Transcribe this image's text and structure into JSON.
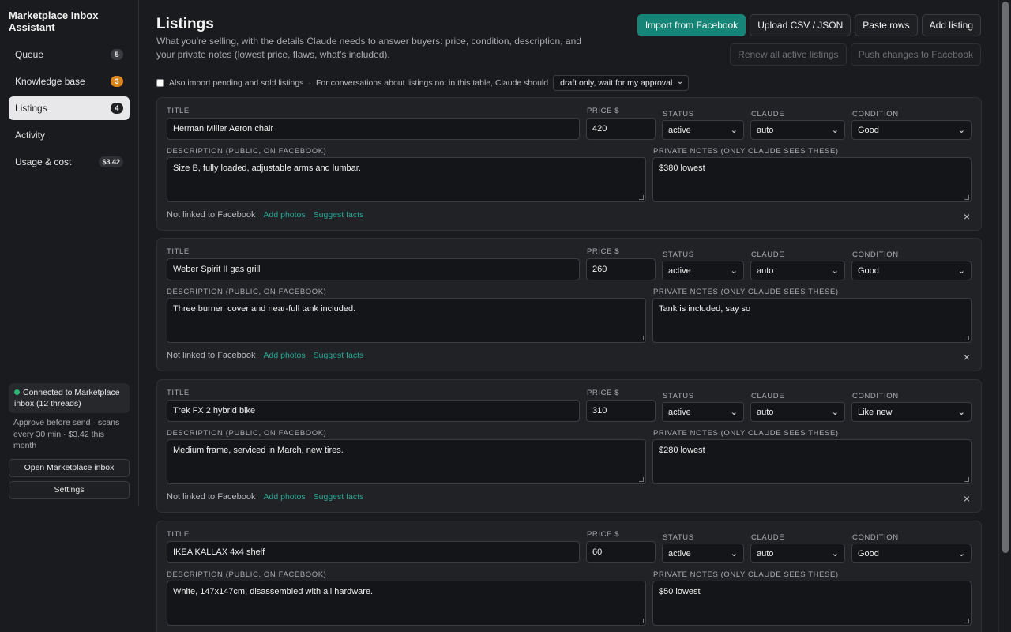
{
  "sidebar": {
    "brand": "Marketplace Inbox Assistant",
    "items": [
      {
        "label": "Queue",
        "badge": "5"
      },
      {
        "label": "Knowledge base",
        "badge": "3"
      },
      {
        "label": "Listings",
        "badge": "4"
      },
      {
        "label": "Activity",
        "badge": ""
      },
      {
        "label": "Usage & cost",
        "badge": "$3.42"
      }
    ],
    "connection": "Connected to Marketplace inbox (12 threads)",
    "status_sub": "Approve before send · scans every 30 min · $3.42 this month",
    "open_inbox": "Open Marketplace inbox",
    "settings": "Settings"
  },
  "header": {
    "title": "Listings",
    "subtitle": "What you're selling, with the details Claude needs to answer buyers: price, condition, description, and your private notes (lowest price, flaws, what's included).",
    "import_fb": "Import from Facebook",
    "upload_csv": "Upload CSV / JSON",
    "paste_rows": "Paste rows",
    "add_listing": "Add listing",
    "renew_all": "Renew all active listings",
    "push_changes": "Push changes to Facebook"
  },
  "import_options": {
    "checkbox_label": "Also import pending and sold listings",
    "separator": "·",
    "policy_label": "For conversations about listings not in this table, Claude should",
    "policy_value": "draft only, wait for my approval"
  },
  "labels": {
    "title": "TITLE",
    "price": "PRICE $",
    "status": "STATUS",
    "claude": "CLAUDE",
    "condition": "CONDITION",
    "description": "DESCRIPTION (PUBLIC, ON FACEBOOK)",
    "private_notes": "PRIVATE NOTES (ONLY CLAUDE SEES THESE)",
    "not_linked": "Not linked to Facebook",
    "add_photos": "Add photos",
    "suggest_facts": "Suggest facts",
    "remove": "×"
  },
  "listings": [
    {
      "title": "Herman Miller Aeron chair",
      "price": "420",
      "status": "active",
      "claude": "auto",
      "condition": "Good",
      "description": "Size B, fully loaded, adjustable arms and lumbar.",
      "notes": "$380 lowest"
    },
    {
      "title": "Weber Spirit II gas grill",
      "price": "260",
      "status": "active",
      "claude": "auto",
      "condition": "Good",
      "description": "Three burner, cover and near-full tank included.",
      "notes": "Tank is included, say so"
    },
    {
      "title": "Trek FX 2 hybrid bike",
      "price": "310",
      "status": "active",
      "claude": "auto",
      "condition": "Like new",
      "description": "Medium frame, serviced in March, new tires.",
      "notes": "$280 lowest"
    },
    {
      "title": "IKEA KALLAX 4x4 shelf",
      "price": "60",
      "status": "active",
      "claude": "auto",
      "condition": "Good",
      "description": "White, 147x147cm, disassembled with all hardware.",
      "notes": "$50 lowest"
    }
  ]
}
